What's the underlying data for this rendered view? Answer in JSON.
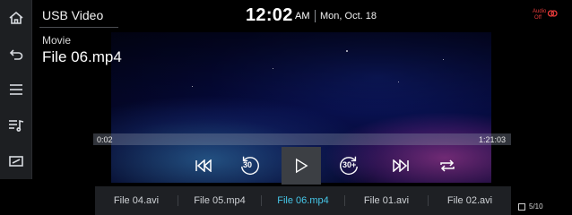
{
  "header": {
    "app_title": "USB Video",
    "clock": "12:02",
    "ampm": "AM",
    "date": "Mon, Oct. 18",
    "audio_status": "Audio\nOff"
  },
  "track": {
    "category": "Movie",
    "filename": "File 06.mp4"
  },
  "progress": {
    "elapsed": "0:02",
    "total": "1:21:03",
    "fraction": 0.0004
  },
  "controls": {
    "rewind_label": "30",
    "forward_label": "30+"
  },
  "playlist": {
    "items": [
      "File 04.avi",
      "File 05.mp4",
      "File 06.mp4",
      "File 01.avi",
      "File 02.avi"
    ],
    "active_index": 2,
    "counter": "5/10"
  },
  "colors": {
    "accent": "#46c6e8",
    "rail_bg": "#1d1f22",
    "playlist_bg": "#1e2024",
    "status_red": "#e83a3a"
  },
  "icons": {
    "rail": [
      "home-icon",
      "back-icon",
      "menu-icon",
      "playlist-icon",
      "screen-icon"
    ]
  }
}
